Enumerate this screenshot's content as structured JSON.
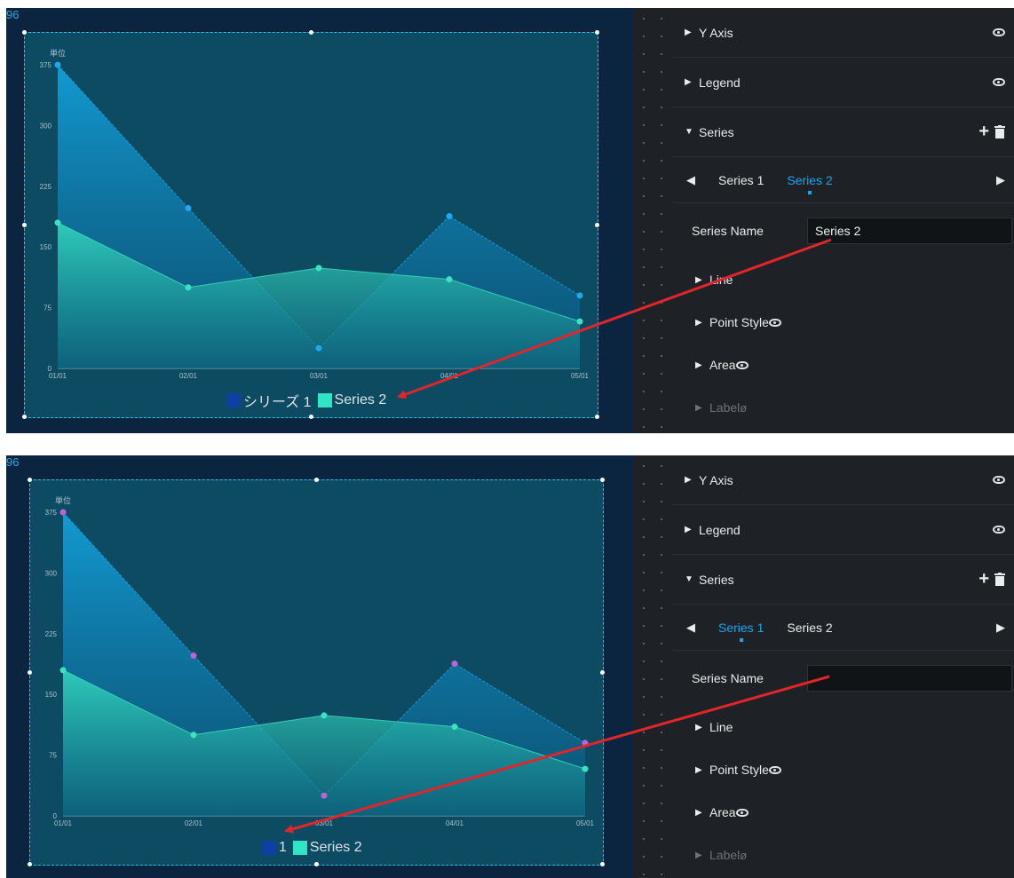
{
  "panels": [
    {
      "corner_label": "96",
      "legend": [
        "シリーズ 1",
        "Series 2"
      ],
      "series1_point_color": "#1ea8f0",
      "series1_swatch": "#0e3fa4",
      "series2_swatch": "#2fe5c5",
      "sidebar": {
        "y_axis": "Y Axis",
        "legend": "Legend",
        "series": "Series",
        "tabs": [
          "Series 1",
          "Series 2"
        ],
        "active_tab": 1,
        "series_name_label": "Series Name",
        "series_name_value": "Series 2",
        "line": "Line",
        "point_style": "Point Style",
        "area": "Area",
        "label": "Label"
      }
    },
    {
      "corner_label": "96",
      "legend": [
        "1",
        "Series 2"
      ],
      "series1_point_color": "#c062d6",
      "series1_swatch": "#0e3fa4",
      "series2_swatch": "#2fe5c5",
      "sidebar": {
        "y_axis": "Y Axis",
        "legend": "Legend",
        "series": "Series",
        "tabs": [
          "Series 1",
          "Series 2"
        ],
        "active_tab": 0,
        "series_name_label": "Series Name",
        "series_name_value": "",
        "line": "Line",
        "point_style": "Point Style",
        "area": "Area",
        "label": "Label"
      }
    }
  ],
  "chart_data": {
    "type": "area",
    "unit_label": "単位",
    "x": [
      "01/01",
      "02/01",
      "03/01",
      "04/01",
      "05/01"
    ],
    "yticks": [
      "0",
      "75",
      "150",
      "225",
      "300",
      "375"
    ],
    "ylim": [
      0,
      375
    ],
    "series": [
      {
        "values": [
          375,
          198,
          25,
          188,
          90
        ]
      },
      {
        "values": [
          180,
          100,
          124,
          110,
          58
        ]
      }
    ]
  },
  "colors": {
    "accent": "#1ba6ee",
    "arrow": "#e0262a",
    "canvas_bg": "#0b2540",
    "sidebar_bg": "#1e2226"
  }
}
